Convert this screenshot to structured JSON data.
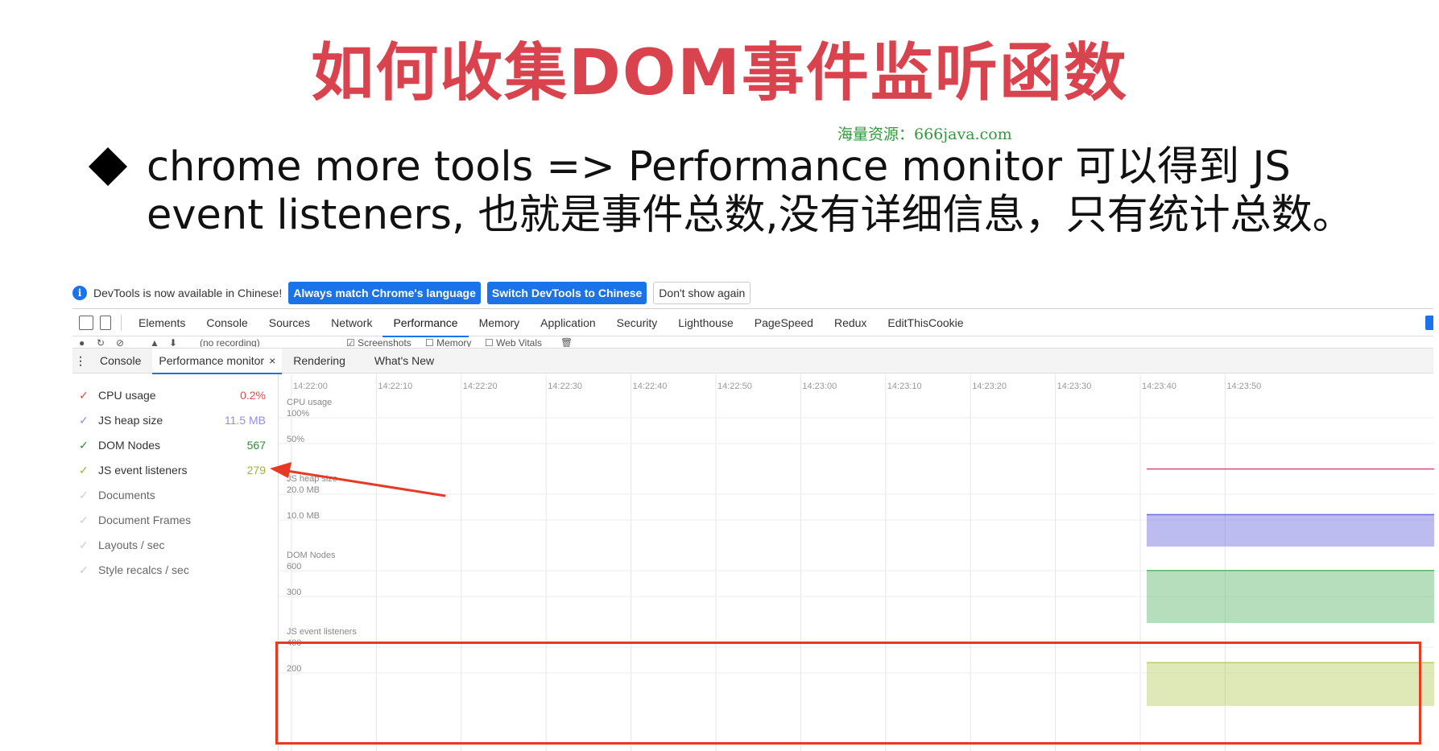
{
  "slide": {
    "title": "如何收集DOM事件监听函数",
    "watermark": "海量资源：666java.com",
    "bullet": "chrome more tools => Performance monitor 可以得到 JS event listeners, 也就是事件总数,没有详细信息，只有统计总数。"
  },
  "infobar": {
    "icon": "info-icon",
    "text": "DevTools is now available in Chinese!",
    "btn_match": "Always match Chrome's language",
    "btn_switch": "Switch DevTools to Chinese",
    "btn_dismiss": "Don't show again"
  },
  "tabs": [
    "Elements",
    "Console",
    "Sources",
    "Network",
    "Performance",
    "Memory",
    "Application",
    "Security",
    "Lighthouse",
    "PageSpeed",
    "Redux",
    "EditThisCookie"
  ],
  "active_tab": "Performance",
  "toolbar": {
    "recording_placeholder": "(no recording)",
    "screenshots": "Screenshots",
    "memory": "Memory",
    "web_vitals": "Web Vitals"
  },
  "drawer": {
    "tabs": [
      "Console",
      "Performance monitor",
      "Rendering",
      "What's New"
    ],
    "active": "Performance monitor",
    "close": "×"
  },
  "metrics": [
    {
      "label": "CPU usage",
      "value": "0.2%",
      "checked": true,
      "color": "#e04a4a"
    },
    {
      "label": "JS heap size",
      "value": "11.5 MB",
      "checked": true,
      "color": "#8f8ee8"
    },
    {
      "label": "DOM Nodes",
      "value": "567",
      "checked": true,
      "color": "#2e8b3a"
    },
    {
      "label": "JS event listeners",
      "value": "279",
      "checked": true,
      "color": "#9ab33a"
    },
    {
      "label": "Documents",
      "value": "",
      "checked": false,
      "color": "#999999"
    },
    {
      "label": "Document Frames",
      "value": "",
      "checked": false,
      "color": "#999999"
    },
    {
      "label": "Layouts / sec",
      "value": "",
      "checked": false,
      "color": "#999999"
    },
    {
      "label": "Style recalcs / sec",
      "value": "",
      "checked": false,
      "color": "#999999"
    }
  ],
  "time_ticks": [
    "14:22:00",
    "14:22:10",
    "14:22:20",
    "14:22:30",
    "14:22:40",
    "14:22:50",
    "14:23:00",
    "14:23:10",
    "14:23:20",
    "14:23:30",
    "14:23:40",
    "14:23:50"
  ],
  "graphs": [
    {
      "name": "CPU usage",
      "ticks": [
        "100%",
        "50%"
      ],
      "color": "#d94a80",
      "level": 0.02
    },
    {
      "name": "JS heap size",
      "ticks": [
        "20.0 MB",
        "10.0 MB"
      ],
      "color": "#6a6ae0",
      "level": 0.575
    },
    {
      "name": "DOM Nodes",
      "ticks": [
        "600",
        "300"
      ],
      "color": "#5fb56a",
      "level": 0.945
    },
    {
      "name": "JS event listeners",
      "ticks": [
        "400",
        "200"
      ],
      "color": "#b8cc60",
      "level": 0.6975
    }
  ],
  "colors": {
    "accent": "#1a73e8",
    "title": "#d9434e",
    "annotation": "#e63a25"
  }
}
